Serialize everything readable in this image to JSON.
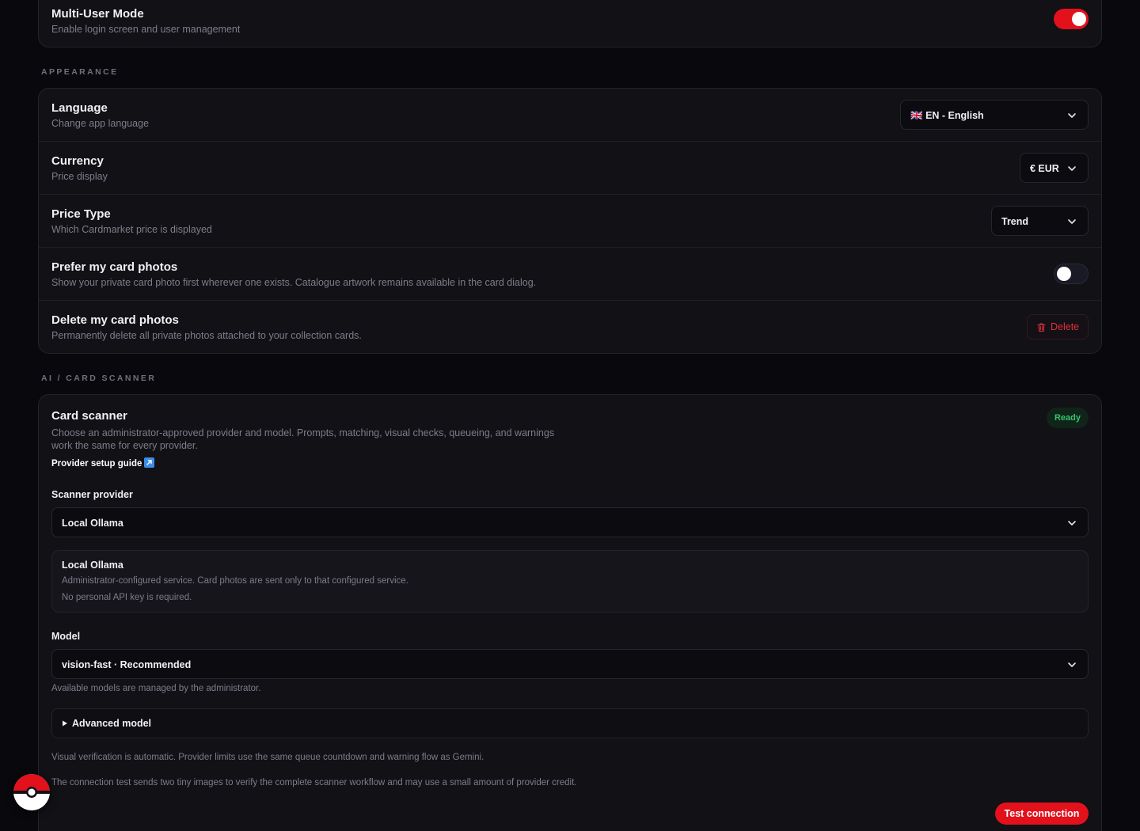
{
  "multi_user": {
    "title": "Multi-User Mode",
    "subtitle": "Enable login screen and user management",
    "enabled": true
  },
  "appearance": {
    "section_label": "APPEARANCE",
    "language": {
      "title": "Language",
      "subtitle": "Change app language",
      "flag": "🇬🇧",
      "value": "EN - English"
    },
    "currency": {
      "title": "Currency",
      "subtitle": "Price display",
      "value": "€ EUR"
    },
    "price_type": {
      "title": "Price Type",
      "subtitle": "Which Cardmarket price is displayed",
      "value": "Trend"
    },
    "prefer_photos": {
      "title": "Prefer my card photos",
      "subtitle": "Show your private card photo first wherever one exists. Catalogue artwork remains available in the card dialog.",
      "enabled": false
    },
    "delete_photos": {
      "title": "Delete my card photos",
      "subtitle": "Permanently delete all private photos attached to your collection cards.",
      "button_label": "Delete"
    }
  },
  "scanner": {
    "section_label": "AI / CARD SCANNER",
    "title": "Card scanner",
    "status_badge": "Ready",
    "description_line1": "Choose an administrator-approved provider and model. Prompts, matching, visual checks, queueing, and warnings",
    "description_line2": "work the same for every provider.",
    "setup_guide_link": "Provider setup guide",
    "provider_label": "Scanner provider",
    "provider_value": "Local Ollama",
    "provider_info": {
      "title": "Local Ollama",
      "line1": "Administrator-configured service. Card photos are sent only to that configured service.",
      "line2": "No personal API key is required."
    },
    "model_label": "Model",
    "model_value": "vision-fast · Recommended",
    "model_hint": "Available models are managed by the administrator.",
    "advanced_label": "Advanced model",
    "verification_note": "Visual verification is automatic. Provider limits use the same queue countdown and warning flow as Gemini.",
    "connection_note": "The connection test sends two tiny images to verify the complete scanner workflow and may use a small amount of provider credit.",
    "test_button": "Test connection"
  },
  "colors": {
    "accent": "#e2111c",
    "background": "#09090d",
    "card": "#111116",
    "ready_green": "#36c46b"
  }
}
